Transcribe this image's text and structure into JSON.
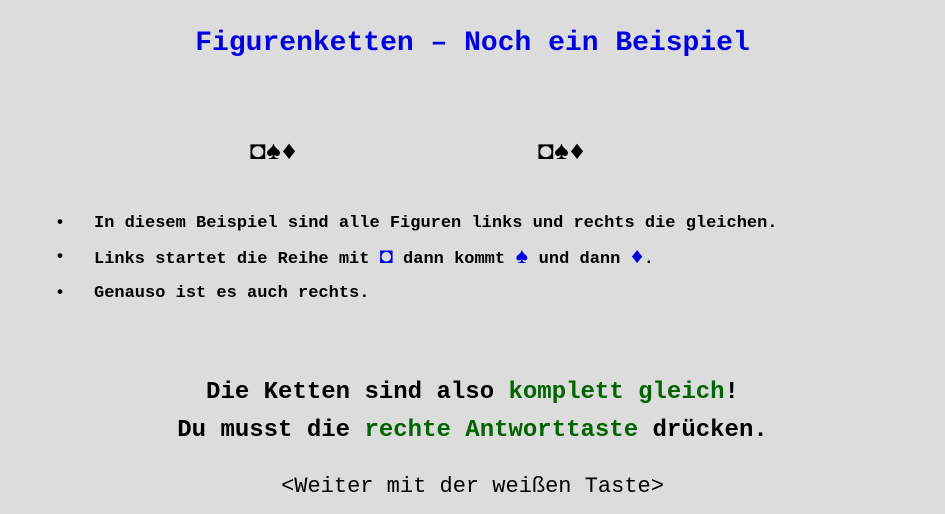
{
  "title": "Figurenketten – Noch ein Beispiel",
  "sequences": {
    "left": [
      "◘",
      "♠",
      "♦"
    ],
    "right": [
      "◘",
      "♠",
      "♦"
    ]
  },
  "bullets": {
    "dot": "•",
    "b1": "In diesem Beispiel sind alle Figuren links und rechts die gleichen.",
    "b2_part1": "Links startet die Reihe mit ",
    "b2_sym1": "◘",
    "b2_part2": " dann kommt ",
    "b2_sym2": "♠",
    "b2_part3": " und dann ",
    "b2_sym3": "♦",
    "b2_part4": ".",
    "b3": "Genauso ist es auch rechts."
  },
  "summary": {
    "line1_a": "Die Ketten sind also ",
    "line1_b": "komplett gleich",
    "line1_c": "!",
    "line2_a": "Du musst die ",
    "line2_b": "rechte Antworttaste",
    "line2_c": " drücken."
  },
  "continue_hint": "<Weiter mit der weißen Taste>",
  "colors": {
    "title": "#0000e0",
    "highlight": "#006400",
    "symbol": "#0000e0",
    "background": "#dcdcdc"
  }
}
